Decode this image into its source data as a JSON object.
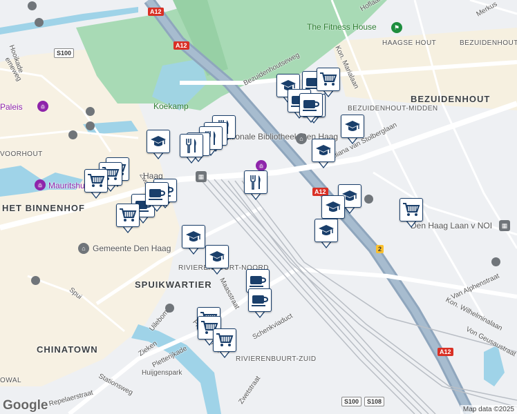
{
  "map": {
    "google_logo": "Google",
    "attribution": "Map data ©2025",
    "districts": [
      "HET BINNENHOF",
      "SPUIKWARTIER",
      "CHINATOWN",
      "BEZUIDENHOUT",
      "BEZUIDENHOUT-MIDDEN",
      "HAAGSE HOUT",
      "BEZUIDENHOUT-WEST",
      "VOORHOUT",
      "RIVIERENBUURT-NOORD",
      "RIVIERENBUURT-ZUID",
      "OWAL"
    ],
    "streets": [
      "Hooikade",
      "emeweg",
      "Bezuidenhoutseweg",
      "Kon. Marialaan",
      "Juliana van Stolberglaan",
      "Maasstraat",
      "Schenkviaduct",
      "Uilebomen",
      "Spui",
      "Zieken",
      "Pletterijkade",
      "Pletterijstraat",
      "Huijgenspark",
      "Stationsweg",
      "Repelaerstraat",
      "Zwetstraat",
      "Van Alphenstraat",
      "Kon. Wilhelminalaan",
      "Von Geusaustraat",
      "Merkus",
      "Zwolle",
      "Hoflaan"
    ],
    "pois": [
      "The Fitness House",
      "Koekamp",
      "Paleis",
      "Mauritshuis",
      "Gemeente Den Haag",
      "Nationale Bibliotheek Den Haag",
      "Den Haag Laan v NOI",
      "Haag",
      "t"
    ],
    "shields": [
      "A12",
      "A12",
      "A12",
      "A12",
      "S100",
      "S100",
      "S108",
      "2"
    ],
    "markers": [
      "education",
      "education",
      "education",
      "education",
      "education",
      "education",
      "education",
      "education",
      "education",
      "restaurant",
      "restaurant",
      "restaurant",
      "restaurant",
      "restaurant",
      "restaurant",
      "cafe",
      "cafe",
      "cafe",
      "cafe",
      "cafe",
      "cafe",
      "cafe",
      "cafe",
      "cafe",
      "shopping",
      "shopping",
      "shopping",
      "shopping",
      "shopping",
      "shopping",
      "shopping",
      "shopping",
      "shopping"
    ]
  }
}
